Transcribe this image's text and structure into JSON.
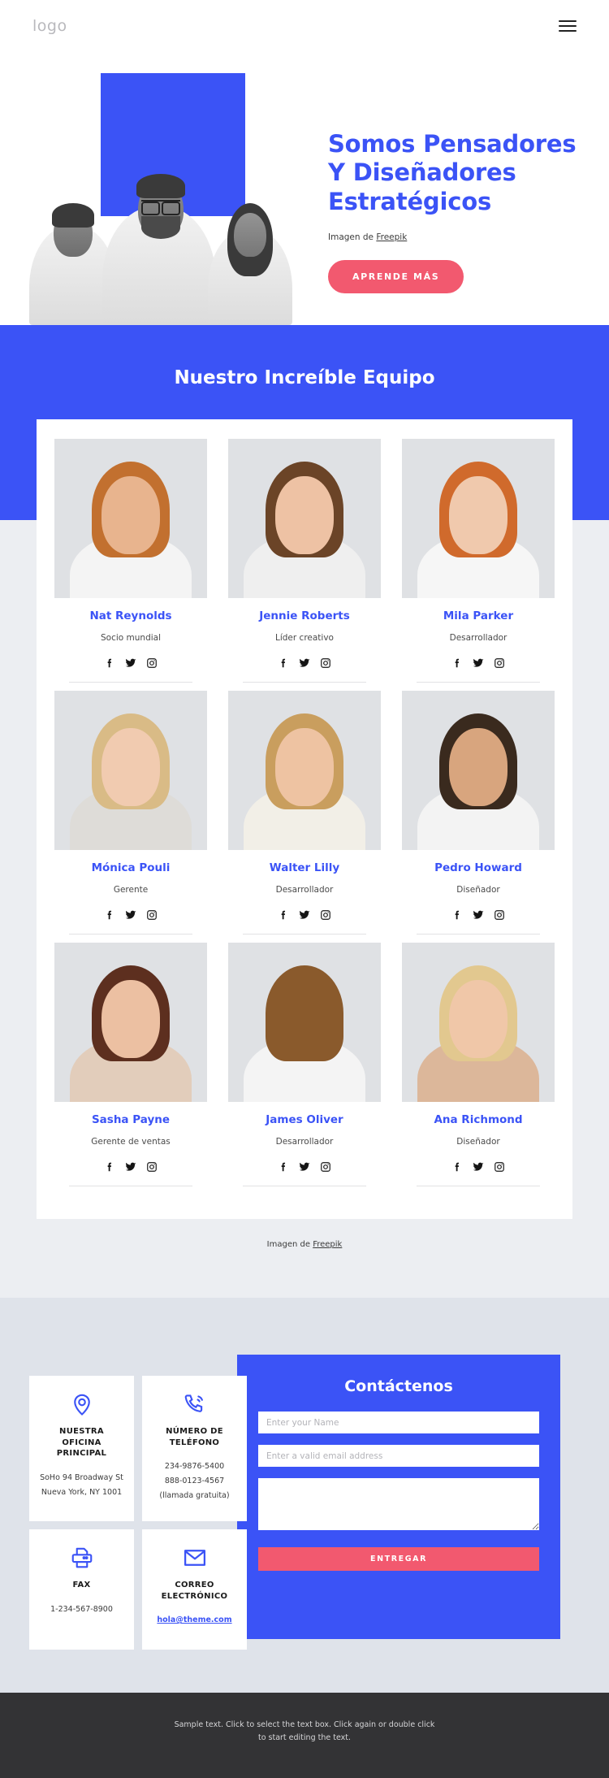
{
  "header": {
    "logo": "logo",
    "menu_icon": "hamburger-menu-icon"
  },
  "hero": {
    "title": "Somos Pensadores Y Diseñadores Estratégicos",
    "credit_prefix": "Imagen de ",
    "credit_link": "Freepik",
    "cta_label": "APRENDE MÁS",
    "accent_color": "#3b53f6",
    "cta_color": "#f2596f"
  },
  "team": {
    "heading": "Nuestro Increíble Equipo",
    "credit_prefix": "Imagen de ",
    "credit_link": "Freepik",
    "social_icons": [
      "facebook-icon",
      "twitter-icon",
      "instagram-icon"
    ],
    "members": [
      {
        "name": "Nat Reynolds",
        "role": "Socio mundial",
        "hair": "#c2702f",
        "skin": "#e8b48e",
        "shirt": "#f4f4f4"
      },
      {
        "name": "Jennie Roberts",
        "role": "Líder creativo",
        "hair": "#6b4427",
        "skin": "#eec2a4",
        "shirt": "#efefef"
      },
      {
        "name": "Mila Parker",
        "role": "Desarrollador",
        "hair": "#d06a2c",
        "skin": "#f0c9ad",
        "shirt": "#f6f6f6"
      },
      {
        "name": "Mónica Pouli",
        "role": "Gerente",
        "hair": "#d9bb86",
        "skin": "#f1cbb0",
        "shirt": "#dedcd8"
      },
      {
        "name": "Walter Lilly",
        "role": "Desarrollador",
        "hair": "#c99e5e",
        "skin": "#eec3a2",
        "shirt": "#f2efe7"
      },
      {
        "name": "Pedro Howard",
        "role": "Diseñador",
        "hair": "#3a2a1e",
        "skin": "#d8a57e",
        "shirt": "#f3f3f3"
      },
      {
        "name": "Sasha Payne",
        "role": "Gerente de ventas",
        "hair": "#5d2f1f",
        "skin": "#ecc0a2",
        "shirt": "#e2cdbb"
      },
      {
        "name": "James Oliver",
        "role": "Desarrollador",
        "hair": "#8a5a2c",
        "skin": "#e8b punto",
        "shirt": "#f4f4f4"
      },
      {
        "name": "Ana Richmond",
        "role": "Diseñador",
        "hair": "#e2c88f",
        "skin": "#f0c7a8",
        "shirt": "#dcb79a"
      }
    ]
  },
  "contact": {
    "form": {
      "title": "Contáctenos",
      "name_placeholder": "Enter your Name",
      "name_value": "",
      "email_placeholder": "Enter a valid email address",
      "email_value": "",
      "message_placeholder": "",
      "message_value": "",
      "submit_label": "ENTREGAR"
    },
    "cards": [
      {
        "icon": "location-pin-icon",
        "title": "NUESTRA OFICINA PRINCIPAL",
        "lines": [
          "SoHo 94 Broadway St",
          "Nueva York, NY 1001"
        ],
        "link": ""
      },
      {
        "icon": "phone-icon",
        "title": "NÚMERO DE TELÉFONO",
        "lines": [
          "234-9876-5400",
          "888-0123-4567 (llamada gratuita)"
        ],
        "link": ""
      },
      {
        "icon": "printer-icon",
        "title": "FAX",
        "lines": [
          "1-234-567-8900"
        ],
        "link": ""
      },
      {
        "icon": "envelope-icon",
        "title": "CORREO ELECTRÓNICO",
        "lines": [],
        "link": "hola@theme.com"
      }
    ]
  },
  "footer": {
    "text": "Sample text. Click to select the text box. Click again or double click to start editing the text."
  }
}
